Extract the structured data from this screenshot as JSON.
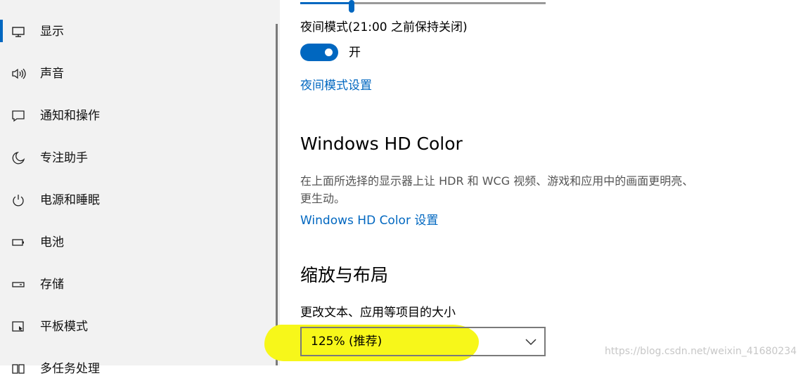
{
  "sidebar": {
    "items": [
      {
        "label": "显示",
        "icon": "monitor-icon"
      },
      {
        "label": "声音",
        "icon": "speaker-icon"
      },
      {
        "label": "通知和操作",
        "icon": "notification-icon"
      },
      {
        "label": "专注助手",
        "icon": "moon-icon"
      },
      {
        "label": "电源和睡眠",
        "icon": "power-icon"
      },
      {
        "label": "电池",
        "icon": "battery-icon"
      },
      {
        "label": "存储",
        "icon": "storage-icon"
      },
      {
        "label": "平板模式",
        "icon": "tablet-icon"
      },
      {
        "label": "多任务处理",
        "icon": "multitask-icon"
      }
    ],
    "selected_index": 0
  },
  "main": {
    "brightness_level": 0.21,
    "night_mode": {
      "label": "夜间模式(21:00 之前保持关闭)",
      "toggle_state": "开",
      "is_on": true,
      "settings_link": "夜间模式设置"
    },
    "hd_color": {
      "heading": "Windows HD Color",
      "description": "在上面所选择的显示器上让 HDR 和 WCG 视频、游戏和应用中的画面更明亮、更生动。",
      "link": "Windows HD Color 设置"
    },
    "scale_layout": {
      "heading": "缩放与布局",
      "label": "更改文本、应用等项目的大小",
      "selected_value": "125% (推荐)"
    }
  },
  "watermark": "https://blog.csdn.net/weixin_41680234",
  "colors": {
    "accent": "#0067c0",
    "sidebar_bg": "#f2f2f2",
    "highlight": "#f7f71a"
  }
}
